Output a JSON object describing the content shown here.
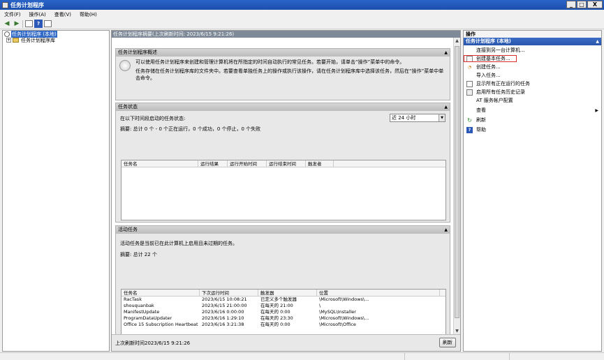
{
  "window": {
    "title": "任务计划程序",
    "btn_min": "_",
    "btn_max": "□",
    "btn_close": "X"
  },
  "menu": [
    "文件(F)",
    "操作(A)",
    "查看(V)",
    "帮助(H)"
  ],
  "tree": {
    "root": "任务计划程序 (本地)",
    "child": "任务计划程序库"
  },
  "center": {
    "header": "任务计划程序摘要(上次刷新时间: 2023/6/15 9:21:26)",
    "overview": {
      "title": "任务计划程序概述",
      "p1": "可以使用任务计划程序来创建和管理计算机将在所指定的时间自动执行的常见任务。若要开始，请单击“操作”菜单中的命令。",
      "p2": "任务存储在任务计划程序库的文件夹中。若要查看单独任务上的操作或执行该操作，请在任务计划程序库中选择该任务，然后在“操作”菜单中单击命令。"
    },
    "status": {
      "title": "任务状态",
      "label": "在以下时间段启动的任务状态:",
      "select_value": "近 24 小时",
      "summary": "摘要: 总计 0 个 - 0 个正在运行，0 个成功，0 个停止，0 个失败",
      "columns": [
        "任务名",
        "运行结果",
        "运行开始时间",
        "运行结束时间",
        "触发者"
      ]
    },
    "active": {
      "title": "活动任务",
      "desc": "活动任务是当前已在此计算机上启用且未过期的任务。",
      "summary": "摘要: 总计 22 个",
      "columns": [
        "任务名",
        "下次运行时间",
        "触发器",
        "位置"
      ],
      "rows": [
        [
          "RacTask",
          "2023/6/15 10:08:21",
          "已定义多个触发器",
          "\\Microsoft\\Windows\\..."
        ],
        [
          "shouquanbak",
          "2023/6/15 21:00:00",
          "在每天的 21:00",
          "\\"
        ],
        [
          "ManifestUpdate",
          "2023/6/16 0:00:00",
          "在每天的 0:00",
          "\\MySQL\\Installer"
        ],
        [
          "ProgramDataUpdater",
          "2023/6/16 1:29:10",
          "在每天的 23:30",
          "\\Microsoft\\Windows\\..."
        ],
        [
          "Office 15 Subscription Heartbeat",
          "2023/6/16 3:21:38",
          "在每天的 0:00",
          "\\Microsoft\\Office"
        ]
      ]
    },
    "footer": {
      "text": "上次刷新时间2023/6/15 9:21:26",
      "refresh": "刷新"
    }
  },
  "actions": {
    "header": "操作",
    "sub": "任务计划程序 (本地)",
    "items": [
      {
        "label": "连接到另一台计算机...",
        "icon": "none-icon"
      },
      {
        "label": "创建基本任务...",
        "icon": "wizard-icon"
      },
      {
        "label": "创建任务...",
        "icon": "clock-icon"
      },
      {
        "label": "导入任务...",
        "icon": "none-icon"
      },
      {
        "label": "显示所有正在运行的任务",
        "icon": "list-icon"
      },
      {
        "label": "启用所有任务历史记录",
        "icon": "history-icon"
      },
      {
        "label": "AT 服务帐户配置",
        "icon": "none-icon"
      },
      {
        "label": "查看",
        "icon": "none-icon"
      },
      {
        "label": "刷新",
        "icon": "refresh-icon"
      },
      {
        "label": "帮助",
        "icon": "help-icon"
      }
    ],
    "highlight_color": "#d82c2c"
  }
}
